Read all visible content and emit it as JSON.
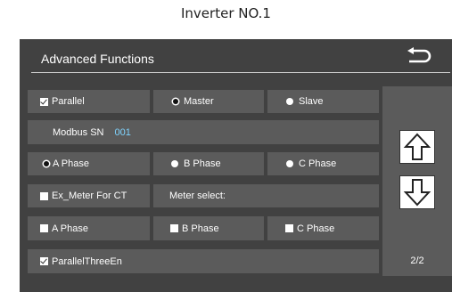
{
  "caption": "Inverter NO.1",
  "header": {
    "title": "Advanced Functions",
    "back_icon": "back-arrow-icon"
  },
  "rows": {
    "parallel": {
      "label": "Parallel",
      "checked": true
    },
    "master": {
      "label": "Master",
      "selected": true
    },
    "slave": {
      "label": "Slave",
      "selected": false
    },
    "modbus": {
      "label": "Modbus SN",
      "value": "001"
    },
    "phase_a": {
      "label": "A Phase",
      "selected": true
    },
    "phase_b": {
      "label": "B Phase",
      "selected": false
    },
    "phase_c": {
      "label": "C Phase",
      "selected": false
    },
    "ex_meter": {
      "label": "Ex_Meter For CT",
      "checked": false
    },
    "meter_select": {
      "label": "Meter select:",
      "value": ""
    },
    "chk_a": {
      "label": "A Phase",
      "checked": false
    },
    "chk_b": {
      "label": "B Phase",
      "checked": false
    },
    "chk_c": {
      "label": "C Phase",
      "checked": false
    },
    "parallel_three": {
      "label": "ParallelThreeEn",
      "checked": true
    }
  },
  "nav": {
    "up_icon": "arrow-up-icon",
    "down_icon": "arrow-down-icon",
    "page": "2/2"
  },
  "colors": {
    "background": "#414141",
    "cell": "#5b5b5b",
    "accent_value": "#7fd4ff"
  }
}
